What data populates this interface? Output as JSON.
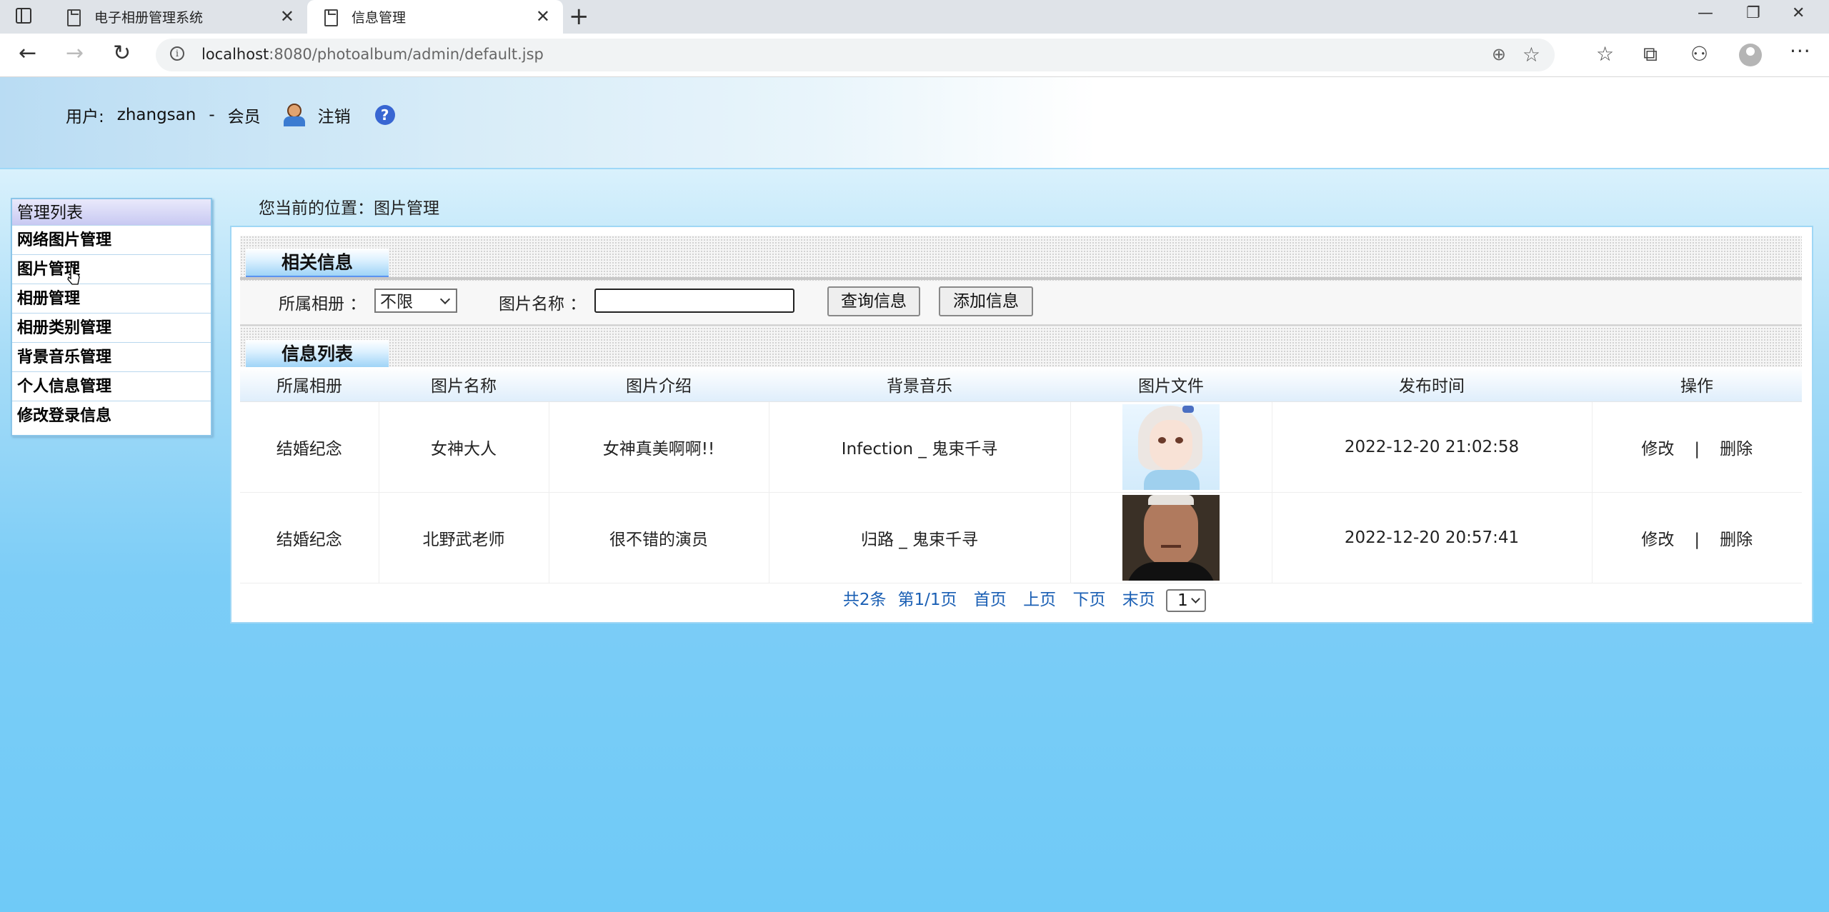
{
  "browser": {
    "tabs": [
      {
        "label": "电子相册管理系统",
        "active": false
      },
      {
        "label": "信息管理",
        "active": true
      }
    ],
    "url_host": "localhost",
    "url_rest": ":8080/photoalbum/admin/default.jsp"
  },
  "header": {
    "user_label": "用户:",
    "username": "zhangsan",
    "separator": "-",
    "role": "会员",
    "logout": "注销",
    "help": "?"
  },
  "menu": {
    "title": "管理列表",
    "items": [
      "网络图片管理",
      "图片管理",
      "相册管理",
      "相册类别管理",
      "背景音乐管理",
      "个人信息管理",
      "修改登录信息"
    ]
  },
  "breadcrumb": "您当前的位置：图片管理",
  "search": {
    "section_title": "相关信息",
    "album_label": "所属相册 ：",
    "album_value": "不限",
    "name_label": "图片名称 ：",
    "name_value": "",
    "query_button": "查询信息",
    "add_button": "添加信息"
  },
  "list": {
    "section_title": "信息列表",
    "columns": [
      "所属相册",
      "图片名称",
      "图片介绍",
      "背景音乐",
      "图片文件",
      "发布时间",
      "操作"
    ],
    "rows": [
      {
        "album": "结婚纪念",
        "name": "女神大人",
        "intro": "女神真美啊啊!!",
        "music": "Infection _ 鬼束千寻",
        "image": "anime-girl-portrait",
        "time": "2022-12-20 21:02:58",
        "edit": "修改",
        "sep": "|",
        "delete": "删除"
      },
      {
        "album": "结婚纪念",
        "name": "北野武老师",
        "intro": "很不错的演员",
        "music": "归路 _ 鬼束千寻",
        "image": "man-portrait",
        "time": "2022-12-20 20:57:41",
        "edit": "修改",
        "sep": "|",
        "delete": "删除"
      }
    ]
  },
  "pager": {
    "total": "共2条",
    "page": "第1/1页",
    "first": "首页",
    "prev": "上页",
    "next": "下页",
    "last": "末页",
    "select_value": "1"
  },
  "colors": {
    "accent": "#5a93f0",
    "link": "#1a5fb4",
    "background": "#6fcaf7"
  }
}
